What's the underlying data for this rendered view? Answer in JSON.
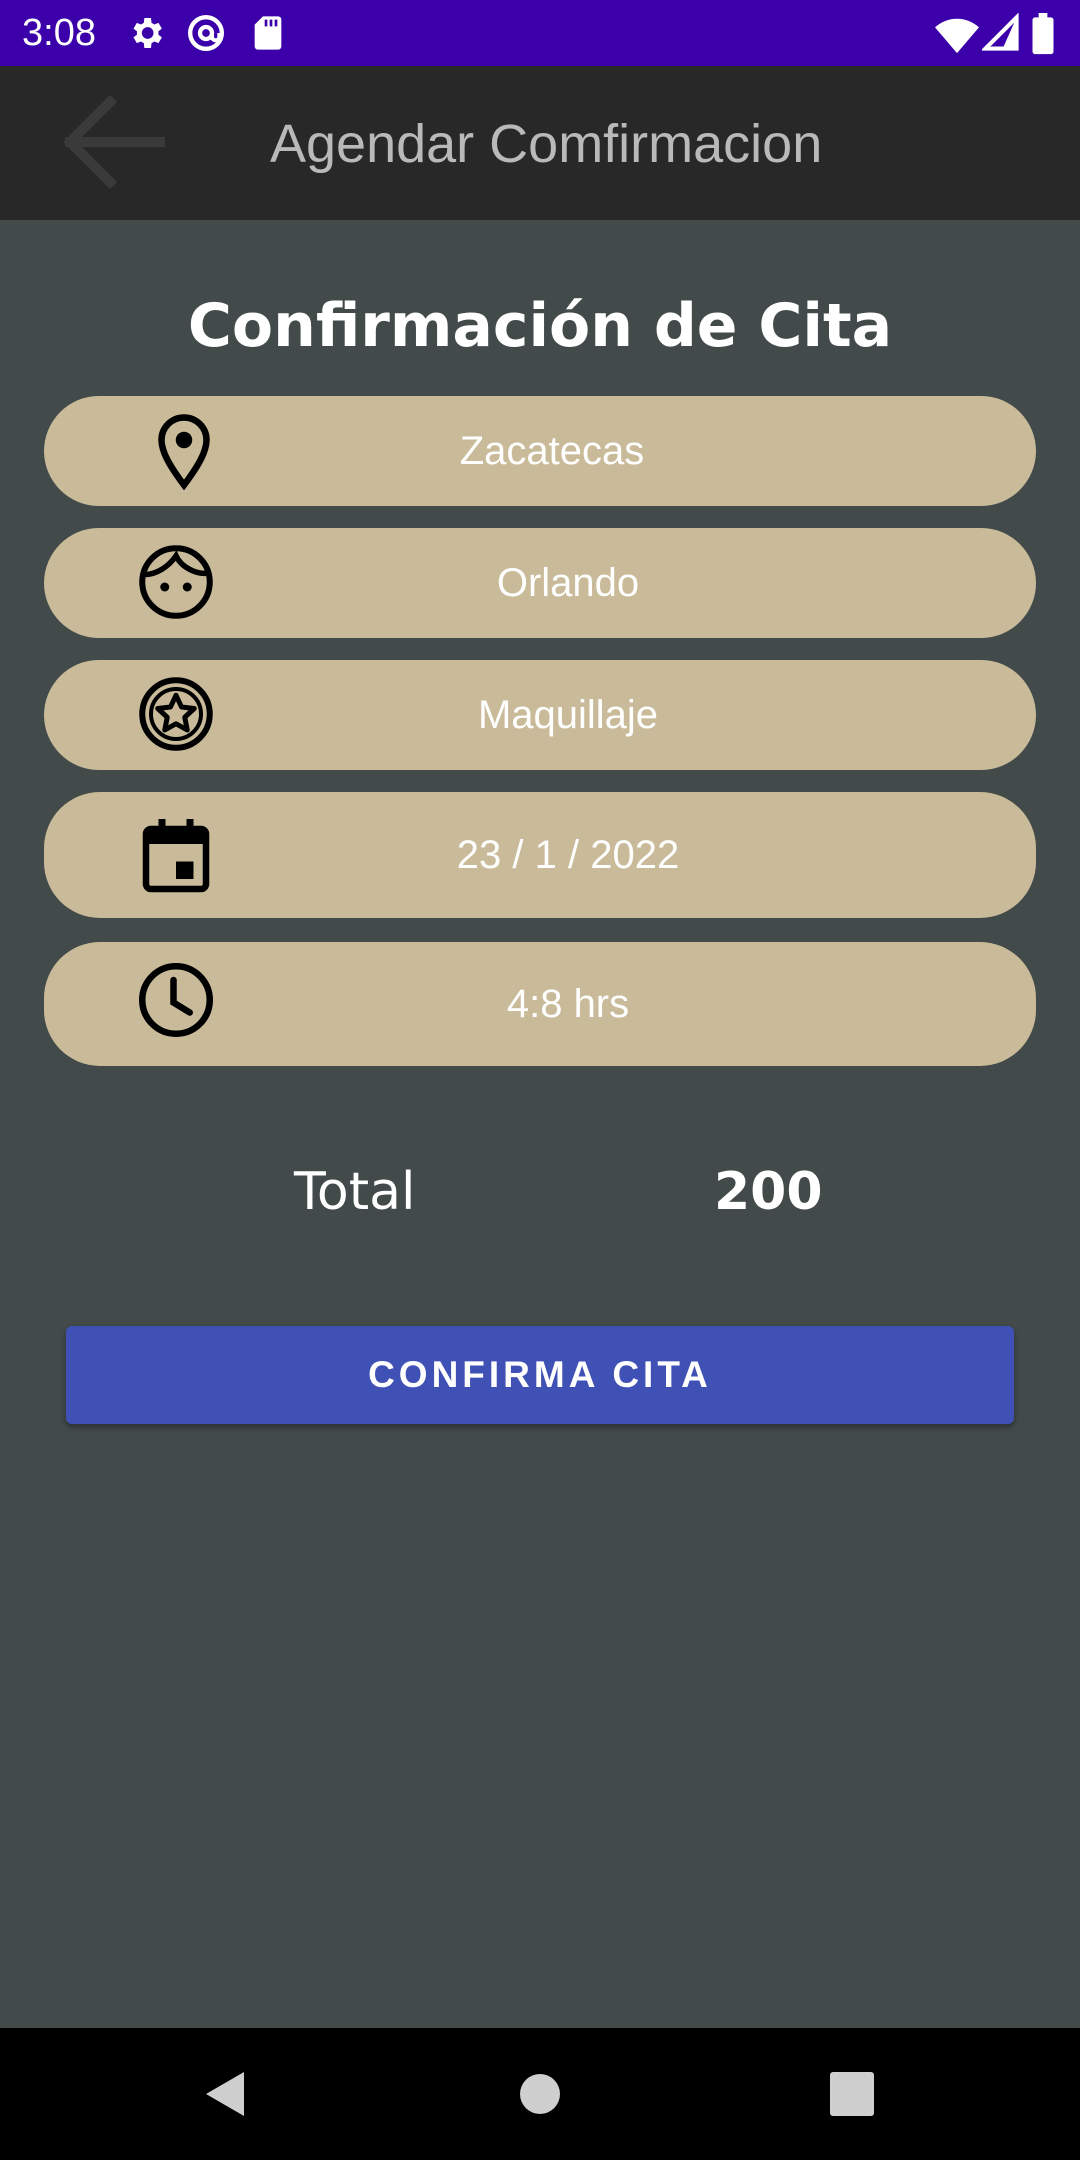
{
  "status_bar": {
    "time": "3:08",
    "left_icons": [
      "gear-icon",
      "at-sign-icon",
      "sd-card-icon"
    ],
    "right_icons": [
      "wifi-icon",
      "signal-icon",
      "battery-icon"
    ],
    "background": "#3b00aa"
  },
  "app_bar": {
    "title": "Agendar Comfirmacion",
    "back_icon": "arrow-back-icon",
    "background": "#282828"
  },
  "confirmation": {
    "title": "Confirmación de Cita",
    "rows": [
      {
        "icon": "location-pin-icon",
        "value": "Zacatecas"
      },
      {
        "icon": "face-icon",
        "value": "Orlando"
      },
      {
        "icon": "star-badge-icon",
        "value": "Maquillaje"
      },
      {
        "icon": "calendar-icon",
        "value": "23 / 1 / 2022"
      },
      {
        "icon": "clock-icon",
        "value": "4:8 hrs"
      }
    ],
    "total_label": "Total",
    "total_value": "200",
    "confirm_button": "CONFIRMA CITA"
  },
  "nav_bar": {
    "buttons": [
      "back-triangle-icon",
      "home-circle-icon",
      "recents-square-icon"
    ]
  },
  "colors": {
    "background": "#424a4a",
    "pill": "#c9bb99",
    "button": "#4051b5",
    "text": "#ffffff"
  }
}
